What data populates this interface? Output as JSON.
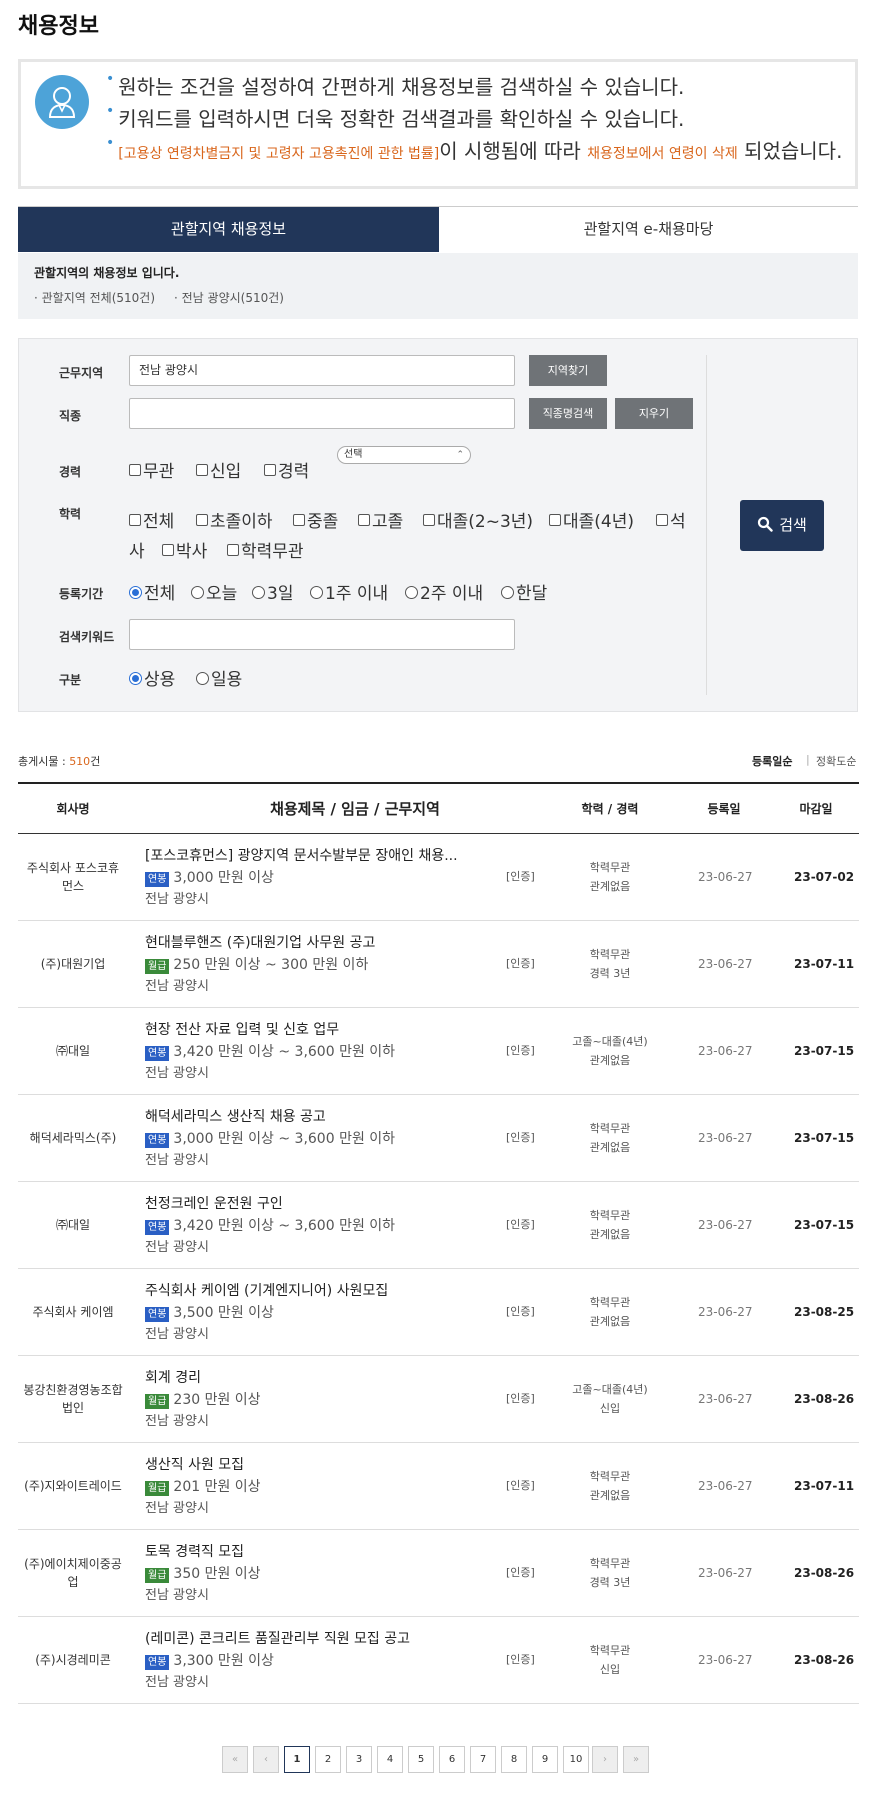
{
  "page_title": "채용정보",
  "info": {
    "line1": "원하는 조건을 설정하여 간편하게 채용정보를 검색하실 수 있습니다.",
    "line2": "키워드를 입력하시면 더욱 정확한 검색결과를 확인하실 수 있습니다.",
    "line3_law": "[고용상 연령차별금지 및 고령자 고용촉진에 관한 법률]",
    "line3_mid": "이 시행됨에 따라 ",
    "line3_orange": "채용정보에서 연령이 삭제",
    "line3_end": " 되었습니다."
  },
  "tabs": [
    "관할지역 채용정보",
    "관할지역 e-채용마당"
  ],
  "region": {
    "title": "관할지역의 채용정보 입니다.",
    "links": [
      "관할지역 전체(510건)",
      "전남 광양시(510건)"
    ]
  },
  "form": {
    "location_label": "근무지역",
    "location_value": "전남 광양시",
    "location_btn": "지역찾기",
    "job_label": "직종",
    "job_btn": "직종명검색",
    "clear_btn": "지우기",
    "career_label": "경력",
    "career_options": [
      "무관",
      "신입",
      "경력"
    ],
    "career_select": "선택",
    "edu_label": "학력",
    "edu_options_row1": [
      "전체",
      "초졸이하",
      "중졸",
      "고졸",
      "대졸(2~3년)",
      "대졸(4년)"
    ],
    "edu_masters_a": "석",
    "edu_masters_b": "사",
    "edu_options_row2": [
      "박사",
      "학력무관"
    ],
    "period_label": "등록기간",
    "period_options": [
      "전체",
      "오늘",
      "3일",
      "1주 이내",
      "2주 이내",
      "한달"
    ],
    "keyword_label": "검색키워드",
    "type_label": "구분",
    "type_options": [
      "상용",
      "일용"
    ],
    "search_btn": "검색"
  },
  "results": {
    "total_label": "총게시물 : ",
    "total_count": "510",
    "total_unit": "건",
    "sort_options": [
      "등록일순",
      "정확도순"
    ]
  },
  "table": {
    "headers": [
      "회사명",
      "채용제목 / 임금 / 근무지역",
      "학력 / 경력",
      "등록일",
      "마감일"
    ],
    "rows": [
      {
        "company": "주식회사 포스코휴먼스",
        "title": "[포스코휴먼스] 광양지역 문서수발부문 장애인 채용...",
        "pay_type": "연봉",
        "pay": "3,000 만원 이상",
        "loc": "전남 광양시",
        "cert": "[인증]",
        "edu": "학력무관",
        "career": "관계없음",
        "reg": "23-06-27",
        "end": "23-07-02"
      },
      {
        "company": "(주)대원기업",
        "title": "현대블루핸즈 (주)대원기업 사무원 공고",
        "pay_type": "월급",
        "pay": "250 만원 이상 ~ 300 만원 이하",
        "loc": "전남 광양시",
        "cert": "[인증]",
        "edu": "학력무관",
        "career": "경력 3년",
        "reg": "23-06-27",
        "end": "23-07-11"
      },
      {
        "company": "㈜대일",
        "title": "현장 전산 자료 입력 및 신호 업무",
        "pay_type": "연봉",
        "pay": "3,420 만원 이상 ~ 3,600 만원 이하",
        "loc": "전남 광양시",
        "cert": "[인증]",
        "edu": "고졸~대졸(4년)",
        "career": "관계없음",
        "reg": "23-06-27",
        "end": "23-07-15"
      },
      {
        "company": "해덕세라믹스(주)",
        "title": "해덕세라믹스 생산직 채용 공고",
        "pay_type": "연봉",
        "pay": "3,000 만원 이상 ~ 3,600 만원 이하",
        "loc": "전남 광양시",
        "cert": "[인증]",
        "edu": "학력무관",
        "career": "관계없음",
        "reg": "23-06-27",
        "end": "23-07-15"
      },
      {
        "company": "㈜대일",
        "title": "천정크레인 운전원 구인",
        "pay_type": "연봉",
        "pay": "3,420 만원 이상 ~ 3,600 만원 이하",
        "loc": "전남 광양시",
        "cert": "[인증]",
        "edu": "학력무관",
        "career": "관계없음",
        "reg": "23-06-27",
        "end": "23-07-15"
      },
      {
        "company": "주식회사 케이엠",
        "title": "주식회사 케이엠 (기계엔지니어) 사원모집",
        "pay_type": "연봉",
        "pay": "3,500 만원 이상",
        "loc": "전남 광양시",
        "cert": "[인증]",
        "edu": "학력무관",
        "career": "관계없음",
        "reg": "23-06-27",
        "end": "23-08-25"
      },
      {
        "company": "봉강친환경영농조합법인",
        "title": "회계 경리",
        "pay_type": "월급",
        "pay": "230 만원 이상",
        "loc": "전남 광양시",
        "cert": "[인증]",
        "edu": "고졸~대졸(4년)",
        "career": "신입",
        "reg": "23-06-27",
        "end": "23-08-26"
      },
      {
        "company": "(주)지와이트레이드",
        "title": "생산직 사원 모집",
        "pay_type": "월급",
        "pay": "201 만원 이상",
        "loc": "전남 광양시",
        "cert": "[인증]",
        "edu": "학력무관",
        "career": "관계없음",
        "reg": "23-06-27",
        "end": "23-07-11"
      },
      {
        "company": "(주)에이치제이중공업",
        "title": "토목 경력직 모집",
        "pay_type": "월급",
        "pay": "350 만원 이상",
        "loc": "전남 광양시",
        "cert": "[인증]",
        "edu": "학력무관",
        "career": "경력 3년",
        "reg": "23-06-27",
        "end": "23-08-26"
      },
      {
        "company": "(주)시경레미콘",
        "title": "(레미콘) 콘크리트 품질관리부 직원 모집 공고",
        "pay_type": "연봉",
        "pay": "3,300 만원 이상",
        "loc": "전남 광양시",
        "cert": "[인증]",
        "edu": "학력무관",
        "career": "신입",
        "reg": "23-06-27",
        "end": "23-08-26"
      }
    ]
  },
  "pagination": {
    "first": "«",
    "prev": "‹",
    "next": "›",
    "last": "»",
    "pages": [
      "1",
      "2",
      "3",
      "4",
      "5",
      "6",
      "7",
      "8",
      "9",
      "10"
    ],
    "current": "1"
  },
  "colors": {
    "navy": "#213659",
    "accent_orange": "#d9661c",
    "badge_yearly": "#2a5fc4",
    "badge_monthly": "#3a8a3a"
  },
  "icons": {
    "info": "person-icon",
    "search": "search-icon"
  }
}
